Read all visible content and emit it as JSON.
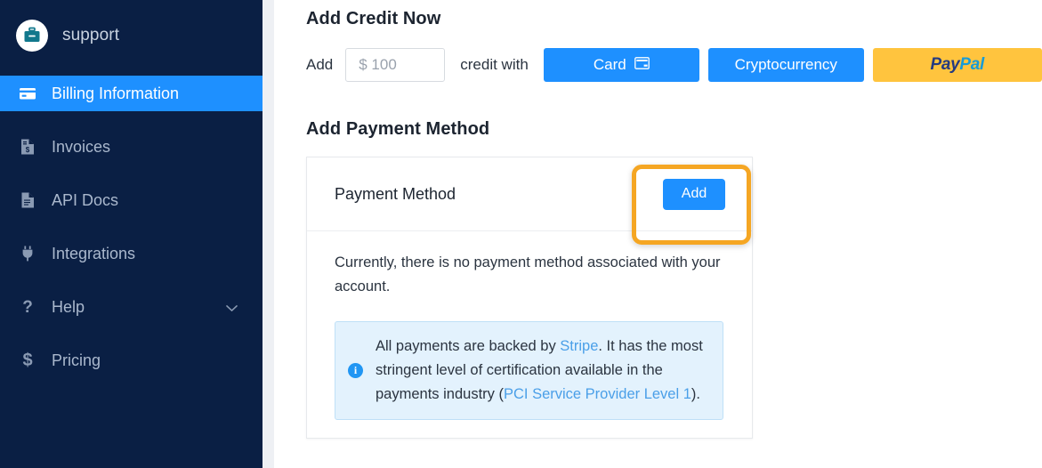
{
  "sidebar": {
    "brand": {
      "name": "support",
      "logo_icon": "briefcase-icon"
    },
    "items": [
      {
        "label": "Billing Information",
        "icon": "credit-card-icon",
        "active": true
      },
      {
        "label": "Invoices",
        "icon": "invoice-document-icon",
        "active": false
      },
      {
        "label": "API Docs",
        "icon": "document-icon",
        "active": false
      },
      {
        "label": "Integrations",
        "icon": "plug-icon",
        "active": false
      },
      {
        "label": "Help",
        "icon": "question-mark-icon",
        "active": false,
        "chevron": "chevron-down-icon"
      },
      {
        "label": "Pricing",
        "icon": "dollar-sign-icon",
        "active": false
      }
    ]
  },
  "main": {
    "add_credit": {
      "title": "Add Credit Now",
      "add_label": "Add",
      "amount_value": "$ 100",
      "amount_placeholder": "$ 100",
      "credit_with_label": "credit with",
      "buttons": [
        {
          "label": "Card",
          "icon": "credit-card-icon",
          "color": "#1e90ff"
        },
        {
          "label": "Cryptocurrency",
          "icon": "",
          "color": "#1e90ff"
        },
        {
          "label": "PayPal",
          "icon": "paypal-logo",
          "color": "#ffc43e",
          "logo_part_a": "Pay",
          "logo_part_b": "Pal"
        }
      ]
    },
    "payment_method": {
      "title": "Add Payment Method",
      "card_header_label": "Payment Method",
      "add_button_label": "Add",
      "empty_note": "Currently, there is no payment method associated with your account.",
      "info": {
        "icon": "info-icon",
        "text_1": "All payments are backed by ",
        "link_1": "Stripe",
        "text_2": ". It has the most stringent level of certification available in the payments industry (",
        "link_2": "PCI Service Provider Level 1",
        "text_3": ")."
      }
    }
  },
  "annotation": {
    "highlight_target": "add-payment-method-add-button",
    "color": "#f5a623"
  }
}
